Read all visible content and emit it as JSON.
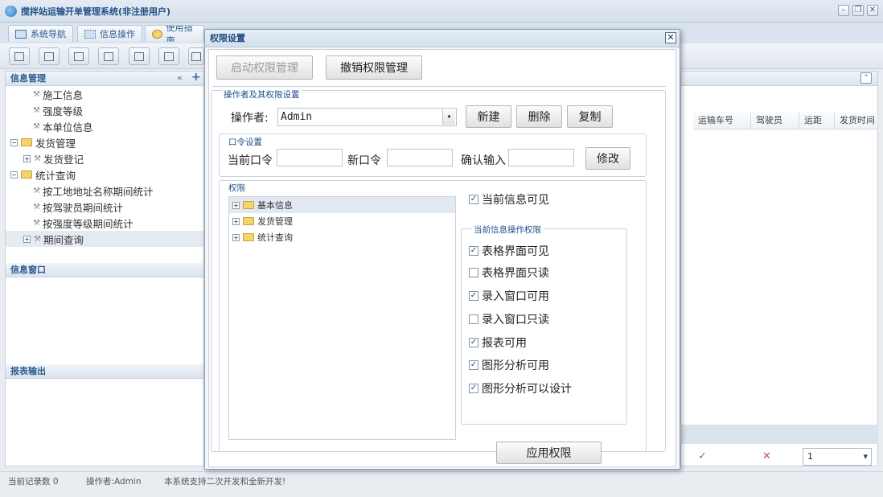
{
  "app": {
    "title": "搅拌站运输开单管理系统(非注册用户)"
  },
  "tabs": [
    "系统导航",
    "信息操作",
    "使用指南"
  ],
  "left_panel": {
    "header": "信息管理",
    "tree": [
      {
        "label": "施工信息",
        "level": 2
      },
      {
        "label": "强度等级",
        "level": 2
      },
      {
        "label": "本单位信息",
        "level": 2
      },
      {
        "label": "发货管理",
        "level": 0,
        "folder": true,
        "expanded": true
      },
      {
        "label": "发货登记",
        "level": 1,
        "collapsed": true
      },
      {
        "label": "统计查询",
        "level": 0,
        "folder": true,
        "expanded": true
      },
      {
        "label": "按工地地址名称期间统计",
        "level": 2
      },
      {
        "label": "按驾驶员期间统计",
        "level": 2
      },
      {
        "label": "按强度等级期间统计",
        "level": 2
      },
      {
        "label": "期间查询",
        "level": 1,
        "collapsed": true,
        "selected": true
      }
    ],
    "info_window": "信息窗口",
    "report_output": "报表输出"
  },
  "grid": {
    "columns": [
      "运输车号",
      "驾驶员",
      "运距",
      "发货时间"
    ],
    "page_value": "1"
  },
  "statusbar": {
    "record_count": "当前记录数 0",
    "operator": "操作者:Admin",
    "notice": "本系统支持二次开发和全新开发!"
  },
  "dialog": {
    "title": "权限设置",
    "btn_enable": "启动权限管理",
    "btn_revoke": "撤销权限管理",
    "operator_group": {
      "title": "操作者及其权限设置",
      "operator_label": "操作者:",
      "operator_value": "Admin",
      "btn_new": "新建",
      "btn_delete": "删除",
      "btn_copy": "复制"
    },
    "password_group": {
      "title": "口令设置",
      "current_label": "当前口令",
      "new_label": "新口令",
      "confirm_label": "确认输入",
      "btn_modify": "修改"
    },
    "perm_group": {
      "title": "权限",
      "tree": [
        "基本信息",
        "发货管理",
        "统计查询"
      ],
      "visible_label": "当前信息可见",
      "visible_checked": true,
      "ops_title": "当前信息操作权限",
      "ops": [
        {
          "label": "表格界面可见",
          "checked": true
        },
        {
          "label": "表格界面只读",
          "checked": false
        },
        {
          "label": "录入窗口可用",
          "checked": true
        },
        {
          "label": "录入窗口只读",
          "checked": false
        },
        {
          "label": "报表可用",
          "checked": true
        },
        {
          "label": "图形分析可用",
          "checked": true
        },
        {
          "label": "图形分析可以设计",
          "checked": true
        }
      ],
      "btn_apply": "应用权限"
    }
  }
}
